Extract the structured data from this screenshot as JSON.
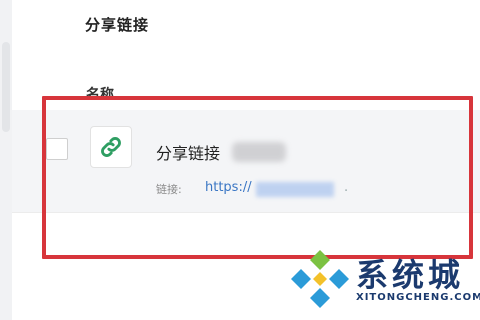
{
  "section": {
    "title": "分享链接"
  },
  "table": {
    "column_name": "名称"
  },
  "item": {
    "title": "分享链接",
    "link_label": "链接:",
    "link_url": "https://",
    "link_suffix": ".",
    "icon": "link-icon"
  },
  "watermark": {
    "text": "系统城",
    "url": "XITONGCHENG.COM"
  },
  "colors": {
    "highlight": "#d7353b",
    "link": "#3a76c4",
    "icon": "#2e9e62",
    "watermark": "#1b3a6e"
  }
}
